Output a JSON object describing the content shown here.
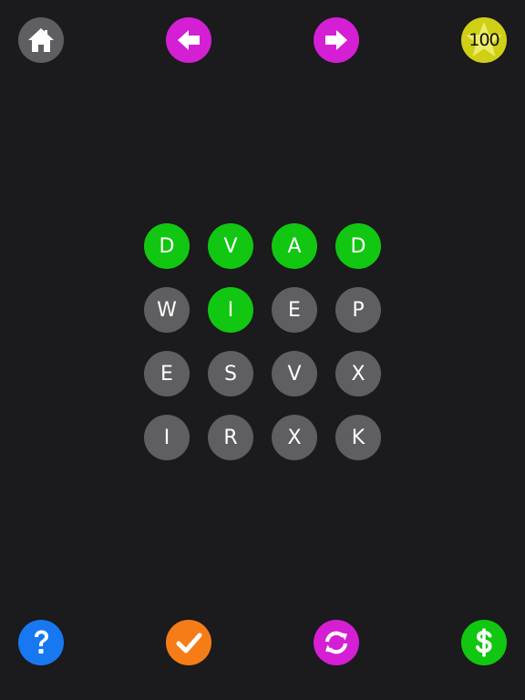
{
  "colors": {
    "background": "#1b1a1c",
    "tile_default": "#5f5e61",
    "tile_selected": "#11c711",
    "nav_arrow": "#d41fd4",
    "coin_badge": "#cfcf16",
    "help": "#1778f2",
    "check": "#f57c17",
    "shuffle": "#d41fd4",
    "buy": "#11c711"
  },
  "header": {
    "home_icon": "home-icon",
    "prev_icon": "arrow-left-icon",
    "next_icon": "arrow-right-icon",
    "coins": "100",
    "coins_icon": "star-icon"
  },
  "footer": {
    "help_icon": "question-icon",
    "check_icon": "checkmark-icon",
    "shuffle_icon": "refresh-icon",
    "buy_icon": "dollar-icon"
  },
  "board": {
    "rows": [
      [
        {
          "letter": "D",
          "selected": true
        },
        {
          "letter": "V",
          "selected": true
        },
        {
          "letter": "A",
          "selected": true
        },
        {
          "letter": "D",
          "selected": true
        }
      ],
      [
        {
          "letter": "W",
          "selected": false
        },
        {
          "letter": "I",
          "selected": true
        },
        {
          "letter": "E",
          "selected": false
        },
        {
          "letter": "P",
          "selected": false
        }
      ],
      [
        {
          "letter": "E",
          "selected": false
        },
        {
          "letter": "S",
          "selected": false
        },
        {
          "letter": "V",
          "selected": false
        },
        {
          "letter": "X",
          "selected": false
        }
      ],
      [
        {
          "letter": "I",
          "selected": false
        },
        {
          "letter": "R",
          "selected": false
        },
        {
          "letter": "X",
          "selected": false
        },
        {
          "letter": "K",
          "selected": false
        }
      ]
    ]
  }
}
